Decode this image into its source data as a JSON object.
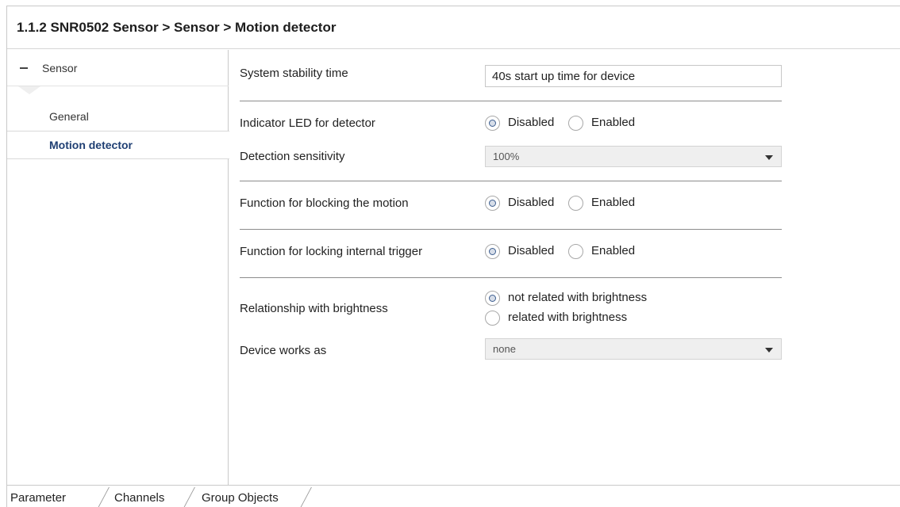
{
  "title": "1.1.2 SNR0502 Sensor > Sensor > Motion detector",
  "sidebar": {
    "group_label": "Sensor",
    "items": [
      {
        "label": "General",
        "active": false
      },
      {
        "label": "Motion detector",
        "active": true
      }
    ]
  },
  "params": {
    "stability": {
      "label": "System stability time",
      "value": "40s start up time for device"
    },
    "indicator_led": {
      "label": "Indicator LED for detector",
      "options": [
        "Disabled",
        "Enabled"
      ],
      "selected": "Disabled"
    },
    "sensitivity": {
      "label": "Detection sensitivity",
      "value": "100%"
    },
    "blocking": {
      "label": "Function for blocking the motion",
      "options": [
        "Disabled",
        "Enabled"
      ],
      "selected": "Disabled"
    },
    "locking": {
      "label": "Function for locking internal trigger",
      "options": [
        "Disabled",
        "Enabled"
      ],
      "selected": "Disabled"
    },
    "brightness": {
      "label": "Relationship with brightness",
      "options": [
        "not related with brightness",
        "related with brightness"
      ],
      "selected": "not related with brightness"
    },
    "works_as": {
      "label": "Device works as",
      "value": "none"
    }
  },
  "tabs": [
    "Parameter",
    "Channels",
    "Group Objects"
  ],
  "colors": {
    "active_item": "#1f3f73",
    "radio_dot": "#3c5d8f",
    "divider": "#8c8c8c"
  }
}
